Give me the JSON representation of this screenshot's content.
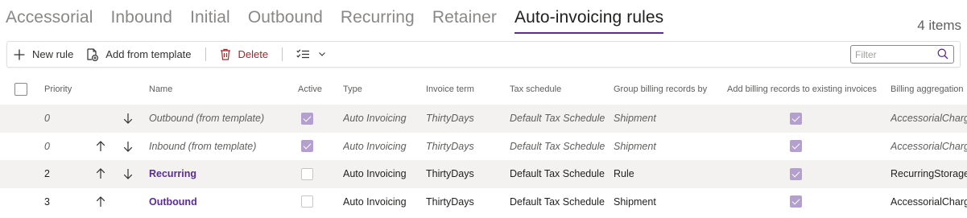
{
  "tabs": [
    {
      "label": "Accessorial",
      "active": false
    },
    {
      "label": "Inbound",
      "active": false
    },
    {
      "label": "Initial",
      "active": false
    },
    {
      "label": "Outbound",
      "active": false
    },
    {
      "label": "Recurring",
      "active": false
    },
    {
      "label": "Retainer",
      "active": false
    },
    {
      "label": "Auto-invoicing rules",
      "active": true
    }
  ],
  "item_count": "4 items",
  "toolbar": {
    "new_rule": "New rule",
    "add_from_template": "Add from template",
    "delete": "Delete"
  },
  "filter": {
    "placeholder": "Filter",
    "value": ""
  },
  "colors": {
    "accent": "#5c2d91",
    "delete": "#a4262c",
    "check": "#b4a0cf",
    "row_shade": "#f3f2f1"
  },
  "columns": {
    "priority": "Priority",
    "name": "Name",
    "active": "Active",
    "type": "Type",
    "invoice_term": "Invoice term",
    "tax_schedule": "Tax schedule",
    "group_by": "Group billing records by",
    "add_existing": "Add billing records to existing invoices",
    "aggregation": "Billing aggregation"
  },
  "rows": [
    {
      "priority": "0",
      "name": "Outbound (from template)",
      "active": true,
      "type": "Auto Invoicing",
      "invoice_term": "ThirtyDays",
      "tax_schedule": "Default Tax Schedule",
      "group_by": "Shipment",
      "add_existing": true,
      "aggregation": "AccessorialCharges"
    },
    {
      "priority": "0",
      "name": "Inbound (from template)",
      "active": true,
      "type": "Auto Invoicing",
      "invoice_term": "ThirtyDays",
      "tax_schedule": "Default Tax Schedule",
      "group_by": "Shipment",
      "add_existing": true,
      "aggregation": "AccessorialCharges"
    },
    {
      "priority": "2",
      "name": "Recurring",
      "active": false,
      "type": "Auto Invoicing",
      "invoice_term": "ThirtyDays",
      "tax_schedule": "Default Tax Schedule",
      "group_by": "Rule",
      "add_existing": true,
      "aggregation": "RecurringStorage"
    },
    {
      "priority": "3",
      "name": "Outbound",
      "active": false,
      "type": "Auto Invoicing",
      "invoice_term": "ThirtyDays",
      "tax_schedule": "Default Tax Schedule",
      "group_by": "Shipment",
      "add_existing": true,
      "aggregation": "AccessorialCharges"
    }
  ],
  "icons": {
    "new_rule": "plus-icon",
    "add_from_template": "template-add-icon",
    "delete": "trash-icon",
    "bulk": "checklist-icon",
    "dropdown": "chevron-down-icon",
    "filter": "search-icon",
    "move_up": "arrow-up-icon",
    "move_down": "arrow-down-icon"
  }
}
